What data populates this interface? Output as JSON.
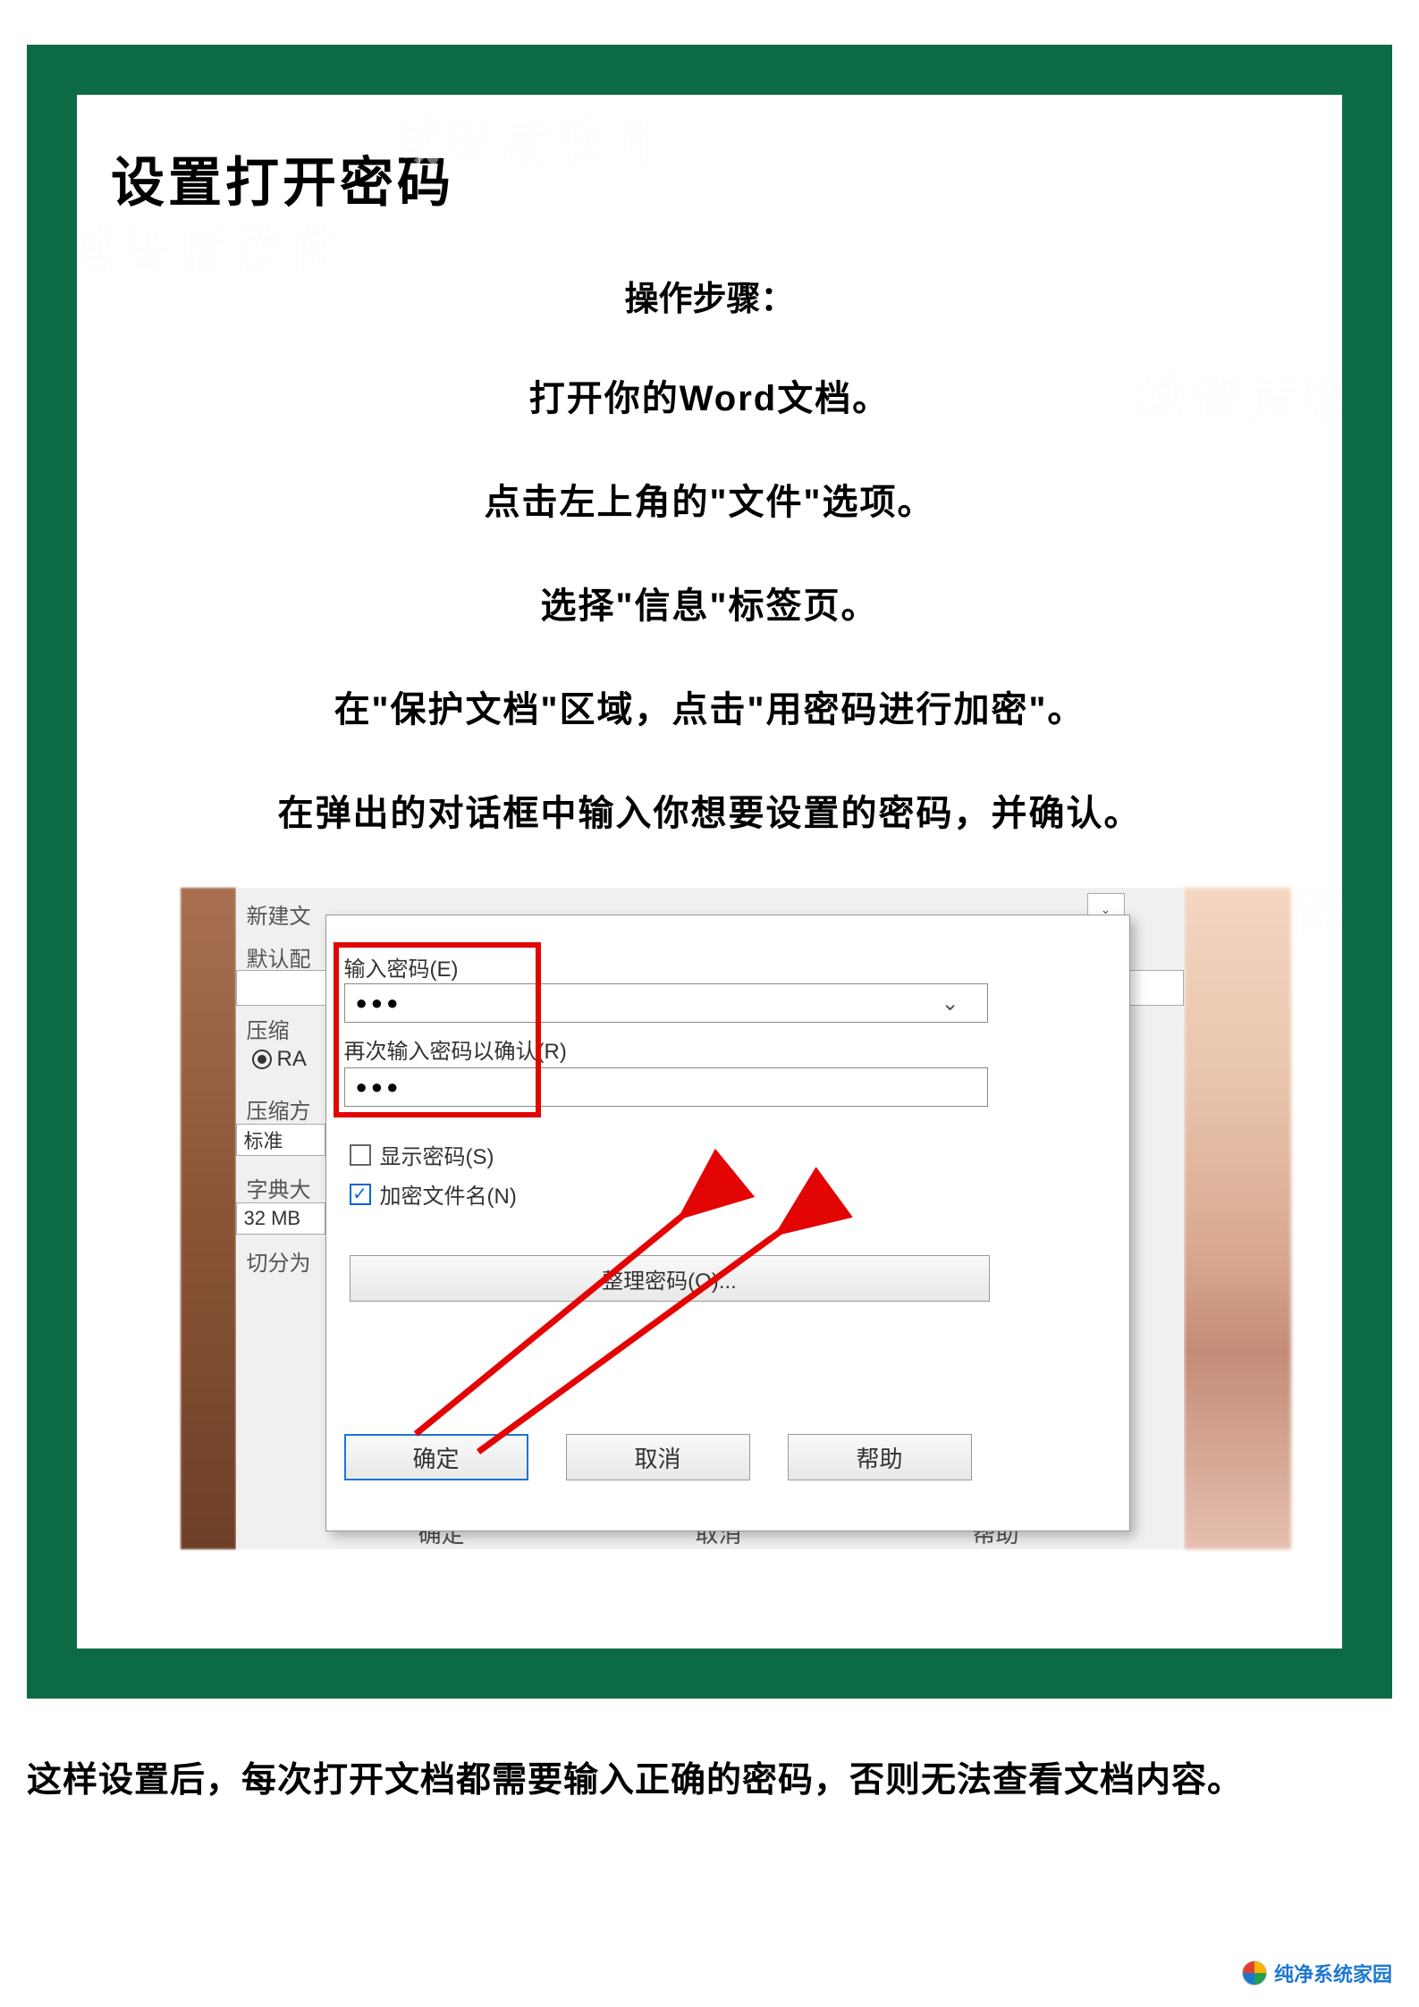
{
  "title": "设置打开密码",
  "stepsHeader": "操作步骤：",
  "steps": [
    "打开你的Word文档。",
    "点击左上角的\"文件\"选项。",
    "选择\"信息\"标签页。",
    "在\"保护文档\"区域，点击\"用密码进行加密\"。",
    "在弹出的对话框中输入你想要设置的密码，并确认。"
  ],
  "screenshot": {
    "sideLabels": {
      "new": "新建文",
      "default": "默认配",
      "compress": "压缩",
      "radio": "RA",
      "method": "压缩方",
      "methodValue": "标准",
      "dict": "字典大",
      "dictValue": "32 MB",
      "split": "切分为"
    },
    "dialog": {
      "pwLabel": "输入密码(E)",
      "pwValue": "●●●",
      "pw2Label": "再次输入密码以确认(R)",
      "pw2Value": "●●●",
      "showPw": "显示密码(S)",
      "encryptNames": "加密文件名(N)",
      "manage": "整理密码(O)...",
      "ok": "确定",
      "cancel": "取消",
      "help": "帮助"
    },
    "bottomCut": {
      "ok": "确定",
      "cancel": "取消",
      "help": "帮助"
    }
  },
  "summary": "这样设置后，每次打开文档都需要输入正确的密码，否则无法查看文档内容。",
  "footer": {
    "brand": "纯净系统家园"
  },
  "watermark": "域智盾软件"
}
